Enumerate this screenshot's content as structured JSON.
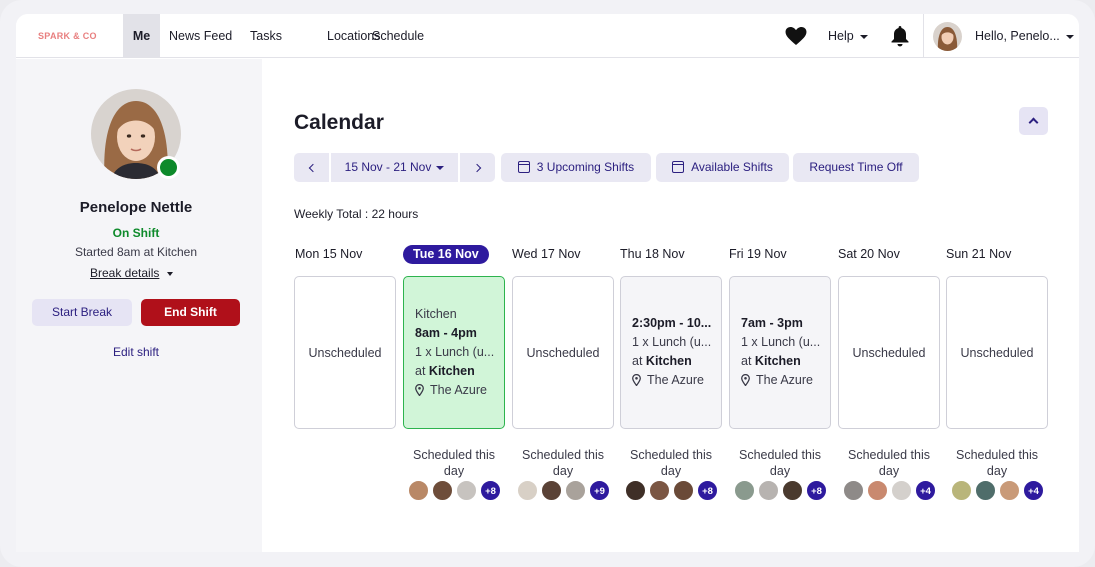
{
  "nav": {
    "brand": "SPARK & CO",
    "items": [
      "Me",
      "News Feed",
      "Tasks",
      "Locations",
      "Schedule"
    ],
    "help": "Help",
    "greeting": "Hello, Penelo..."
  },
  "profile": {
    "name": "Penelope Nettle",
    "status": "On Shift",
    "started": "Started 8am at Kitchen",
    "break_details": "Break details",
    "start_break": "Start Break",
    "end_shift": "End Shift",
    "edit_shift": "Edit shift"
  },
  "calendar": {
    "title": "Calendar",
    "range": "15 Nov - 21 Nov",
    "upcoming": "3 Upcoming Shifts",
    "available": "Available Shifts",
    "time_off": "Request Time Off",
    "weekly_total": "Weekly Total : 22 hours",
    "scheduled_label": "Scheduled this day",
    "unscheduled": "Unscheduled",
    "days": [
      {
        "label": "Mon 15 Nov",
        "more": ""
      },
      {
        "label": "Tue 16 Nov",
        "more": "+8"
      },
      {
        "label": "Wed 17 Nov",
        "more": "+9"
      },
      {
        "label": "Thu 18 Nov",
        "more": "+8"
      },
      {
        "label": "Fri 19 Nov",
        "more": "+8"
      },
      {
        "label": "Sat 20 Nov",
        "more": "+4"
      },
      {
        "label": "Sun 21 Nov",
        "more": "+4"
      }
    ],
    "shifts": {
      "tue": {
        "location": "Kitchen",
        "time": "8am - 4pm",
        "break": "1 x Lunch (u...",
        "at": "at",
        "area": "Kitchen",
        "venue": "The Azure"
      },
      "thu": {
        "time": "2:30pm - 10...",
        "break": "1 x Lunch (u...",
        "at": "at",
        "area": "Kitchen",
        "venue": "The Azure"
      },
      "fri": {
        "time": "7am - 3pm",
        "break": "1 x Lunch (u...",
        "at": "at",
        "area": "Kitchen",
        "venue": "The Azure"
      }
    }
  },
  "colors": {
    "accent": "#2e1a9e",
    "on_shift": "#0e8a2b",
    "end_shift": "#b0101a",
    "today_card": "#d1f5d8"
  }
}
